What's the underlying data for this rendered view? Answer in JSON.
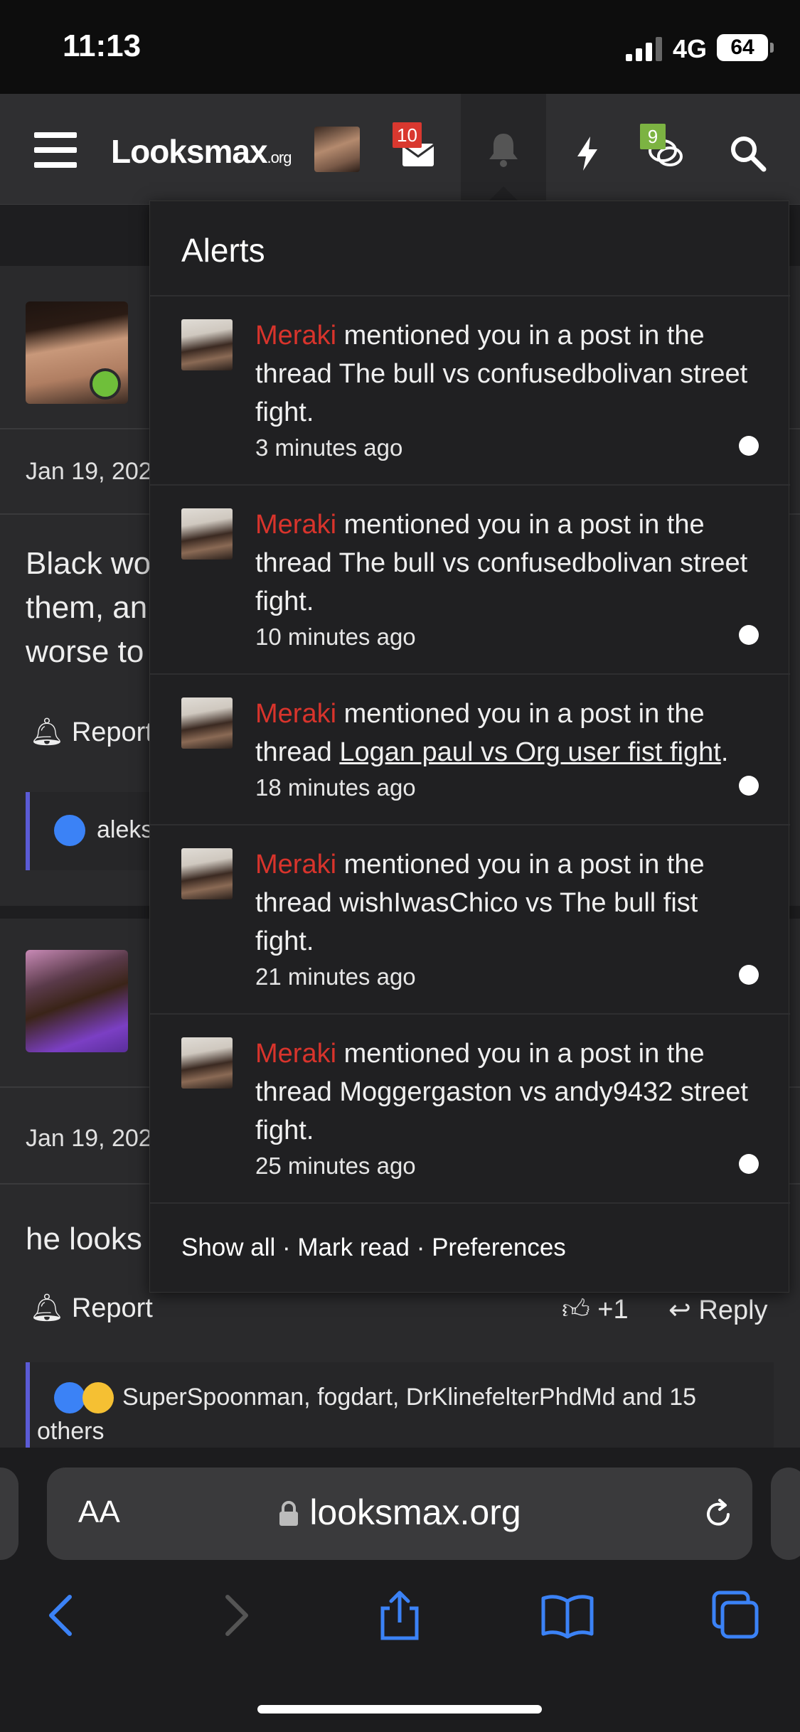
{
  "status_bar": {
    "time": "11:13",
    "network": "4G",
    "battery": "64"
  },
  "nav": {
    "logo_main": "Looksmax",
    "logo_suffix": ".org",
    "inbox_badge": "10",
    "conversations_badge": "9"
  },
  "page": {
    "post1": {
      "date": "Jan 19, 202",
      "text_lines": [
        "Black wo",
        "them, an",
        "worse to"
      ],
      "report": "Report",
      "reaction_users": "aleks"
    },
    "post2": {
      "date": "Jan 19, 202",
      "text": "he looks",
      "report": "Report",
      "like_count": "+1",
      "reply": "Reply",
      "reactions": "SuperSpoonman, fogdart, DrKlinefelterPhdMd and 15",
      "reactions_more": "others"
    }
  },
  "alerts": {
    "title": "Alerts",
    "items": [
      {
        "user": "Meraki",
        "pre": " mentioned you in a post in the thread ",
        "thread": "The bull vs confusedbolivan street fight.",
        "linked": false,
        "time": "3 minutes ago"
      },
      {
        "user": "Meraki",
        "pre": " mentioned you in a post in the thread ",
        "thread": "The bull vs confusedbolivan street fight.",
        "linked": false,
        "time": "10 minutes ago"
      },
      {
        "user": "Meraki",
        "pre": " mentioned you in a post in the thread ",
        "thread": "Logan paul vs Org user fist fight",
        "suffix": ".",
        "linked": true,
        "time": "18 minutes ago"
      },
      {
        "user": "Meraki",
        "pre": " mentioned you in a post in the thread ",
        "thread": "wishIwasChico vs The bull fist fight.",
        "linked": false,
        "time": "21 minutes ago"
      },
      {
        "user": "Meraki",
        "pre": " mentioned you in a post in the thread ",
        "thread": "Moggergaston vs andy9432 street fight.",
        "linked": false,
        "time": "25 minutes ago"
      }
    ],
    "footer": {
      "show_all": "Show all",
      "mark_read": "Mark read",
      "preferences": "Preferences",
      "separator": " · "
    }
  },
  "browser": {
    "aa": "AA",
    "url": "looksmax.org"
  },
  "colors": {
    "username": "#d8342c",
    "badge_red": "#d9382f",
    "badge_green": "#7cb342",
    "accent_blue": "#3b82f6"
  }
}
